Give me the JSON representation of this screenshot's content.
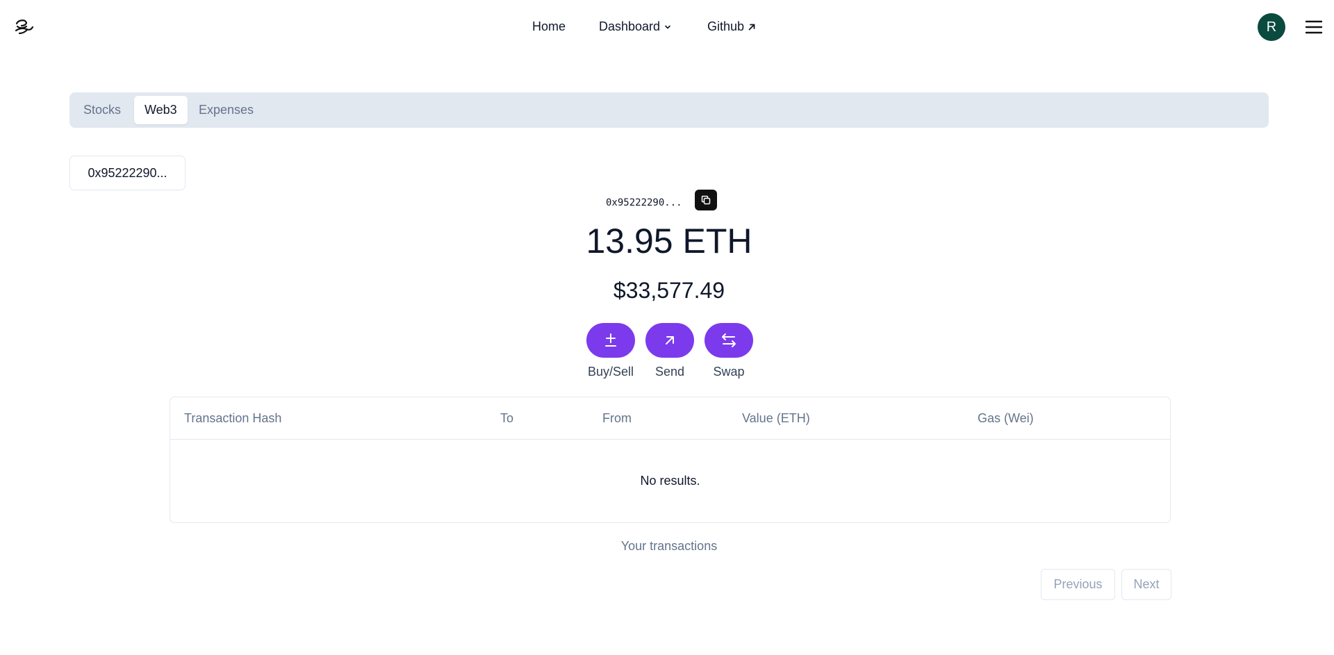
{
  "header": {
    "nav": {
      "home": "Home",
      "dashboard": "Dashboard",
      "github": "Github"
    },
    "avatar_initial": "R"
  },
  "tabs": {
    "stocks": "Stocks",
    "web3": "Web3",
    "expenses": "Expenses",
    "active": "Web3"
  },
  "wallet": {
    "selected": "0x95222290...",
    "address_short": "0x95222290...",
    "balance": "13.95 ETH",
    "usd_value": "$33,577.49"
  },
  "actions": {
    "buy_sell": "Buy/Sell",
    "send": "Send",
    "swap": "Swap"
  },
  "table": {
    "columns": [
      "Transaction Hash",
      "To",
      "From",
      "Value (ETH)",
      "Gas (Wei)"
    ],
    "empty_message": "No results.",
    "caption": "Your transactions"
  },
  "pagination": {
    "previous": "Previous",
    "next": "Next"
  },
  "colors": {
    "accent": "#7c3aed",
    "avatar": "#0b4a3f",
    "tab_bar": "#e2e8f0"
  }
}
